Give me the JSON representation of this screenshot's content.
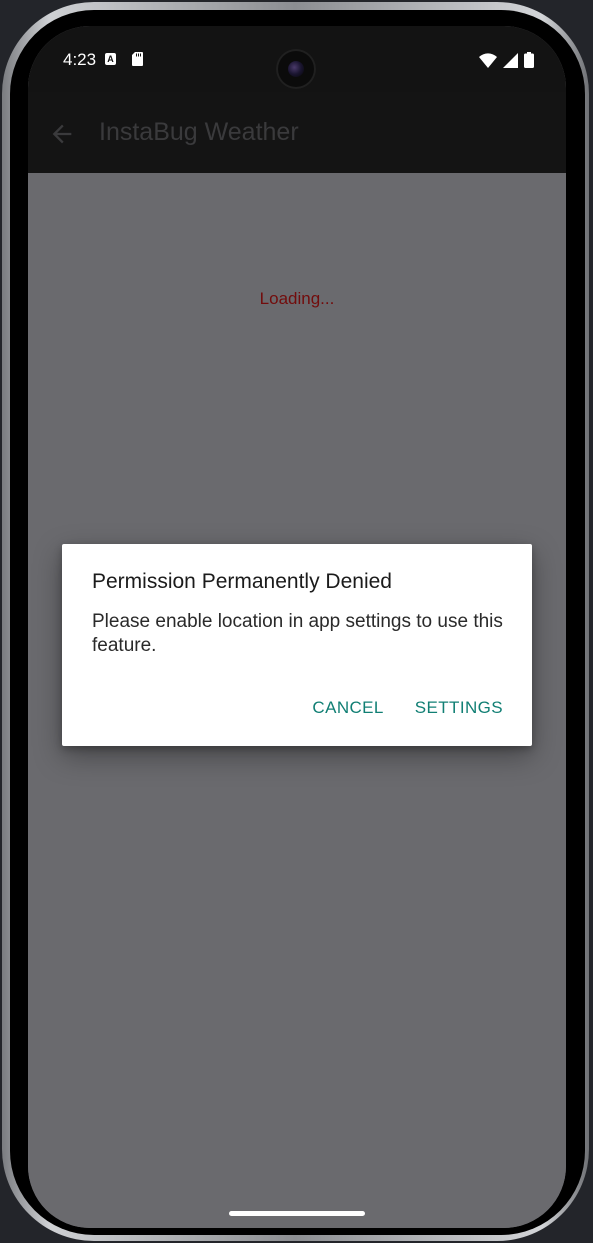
{
  "status_bar": {
    "time": "4:23",
    "left_icons": [
      "a-notification-icon",
      "sd-card-icon"
    ],
    "right_icons": [
      "wifi-icon",
      "cellular-signal-icon",
      "battery-icon"
    ]
  },
  "app_bar": {
    "title": "InstaBug Weather",
    "back_icon": "arrow-back-icon"
  },
  "content": {
    "loading_text": "Loading...",
    "loading_color": "#720c0c"
  },
  "dialog": {
    "title": "Permission Permanently Denied",
    "message": "Please enable location in app settings to use this feature.",
    "cancel_label": "CANCEL",
    "settings_label": "SETTINGS",
    "accent_color": "#117f74"
  },
  "colors": {
    "scrim": "#6a6a6e",
    "app_bar": "#141414",
    "dialog_bg": "#ffffff"
  }
}
